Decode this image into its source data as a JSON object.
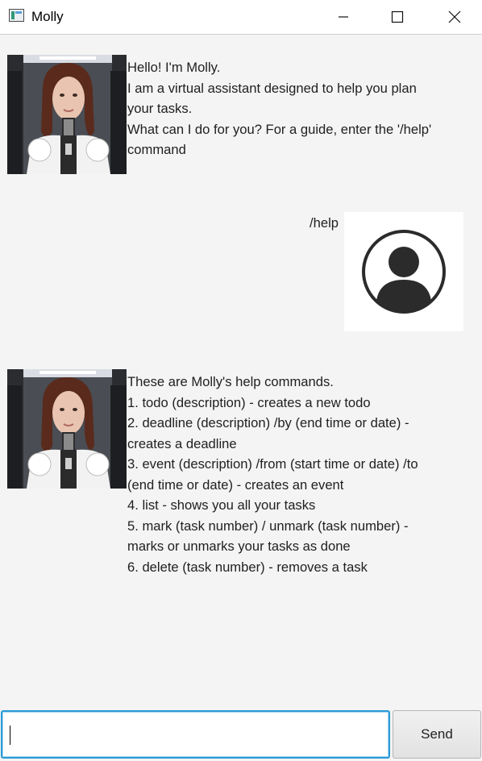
{
  "window": {
    "title": "Molly",
    "icon": "java-app-icon",
    "controls": [
      "minimize-icon",
      "maximize-icon",
      "close-icon"
    ]
  },
  "chat": {
    "messages": [
      {
        "sender": "bot",
        "avatar": "molly-robot-avatar",
        "lines": [
          "Hello! I'm Molly.",
          "I am a virtual assistant designed to help you plan",
          "your tasks.",
          "What can I do for you? For a guide, enter the '/help'",
          "command"
        ]
      },
      {
        "sender": "user",
        "avatar": "user-circle-icon",
        "lines": [
          "/help"
        ]
      },
      {
        "sender": "bot",
        "avatar": "molly-robot-avatar",
        "lines": [
          "These are Molly's help commands.",
          "1. todo (description) - creates a new todo",
          "2. deadline (description) /by (end time or date) -",
          "creates a deadline",
          "3. event (description) /from (start time or date) /to",
          "(end time or date) - creates an event",
          "4. list - shows you all your tasks",
          "5. mark (task number) / unmark (task number) -",
          "marks or unmarks your tasks as done",
          "6. delete (task number) - removes a task"
        ]
      }
    ]
  },
  "input": {
    "value": "",
    "send_label": "Send"
  },
  "colors": {
    "accent": "#2b9bd6",
    "background": "#f4f4f4"
  }
}
